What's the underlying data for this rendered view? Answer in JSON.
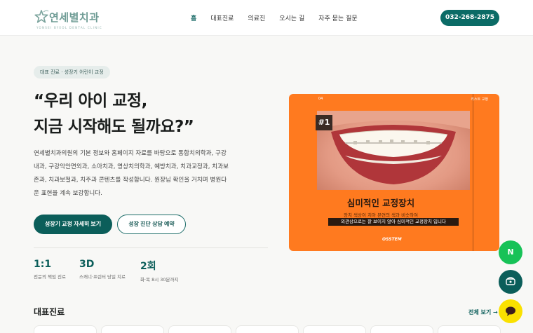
{
  "header": {
    "logo_name": "연세별치과",
    "logo_sub": "YONSEI BYEOL DENTAL CLINIC",
    "nav": [
      "홈",
      "대표진료",
      "의료진",
      "오시는 길",
      "자주 묻는 질문"
    ],
    "phone": "032-268-2875"
  },
  "hero": {
    "badge": "대표 진료 · 성장기 어린이 교정",
    "title_line1": "“우리 아이 교정,",
    "title_line2": "지금 시작해도 될까요?”",
    "description": "연세별치과의원의 기본 정보와 홈페이지 자료를 바탕으로 통합치의학과, 구강내과, 구강악안면외과, 소아치과, 영상치의학과, 예방치과, 치과교정과, 치과보존과, 치과보철과, 치주과 콘텐츠를 작성합니다. 원장님 확인을 거치며 병원다운 표현을 계속 보강합니다.",
    "primary_button": "성장기 교정 자세히 보기",
    "secondary_button": "성장 진단 상담 예약",
    "stats": [
      {
        "value": "1:1",
        "label": "전문의 책임 진료"
      },
      {
        "value": "3D",
        "label": "스캐너·프린터 당일 치료"
      },
      {
        "value": "2회",
        "label": "화·목 8시 30분까지"
      }
    ]
  },
  "promo": {
    "top_left": "04",
    "top_right": "리스트 교정",
    "number": "#1",
    "title": "심미적인 교정장치",
    "sub1": "장치 색상이 치아 본연의 색과 비슷하여",
    "sub2": "외관상으로는 잘 보이지 않아 심미적인 교정장치 입니다",
    "brand": "OSSTEM"
  },
  "fabs": {
    "naver": "N"
  },
  "section": {
    "title": "대표진료",
    "see_all": "전체 보기 →"
  },
  "colors": {
    "accent": "#0b5e5a",
    "promo_bg": "#ff7a1f",
    "naver": "#17c257",
    "kakao": "#fae100"
  }
}
